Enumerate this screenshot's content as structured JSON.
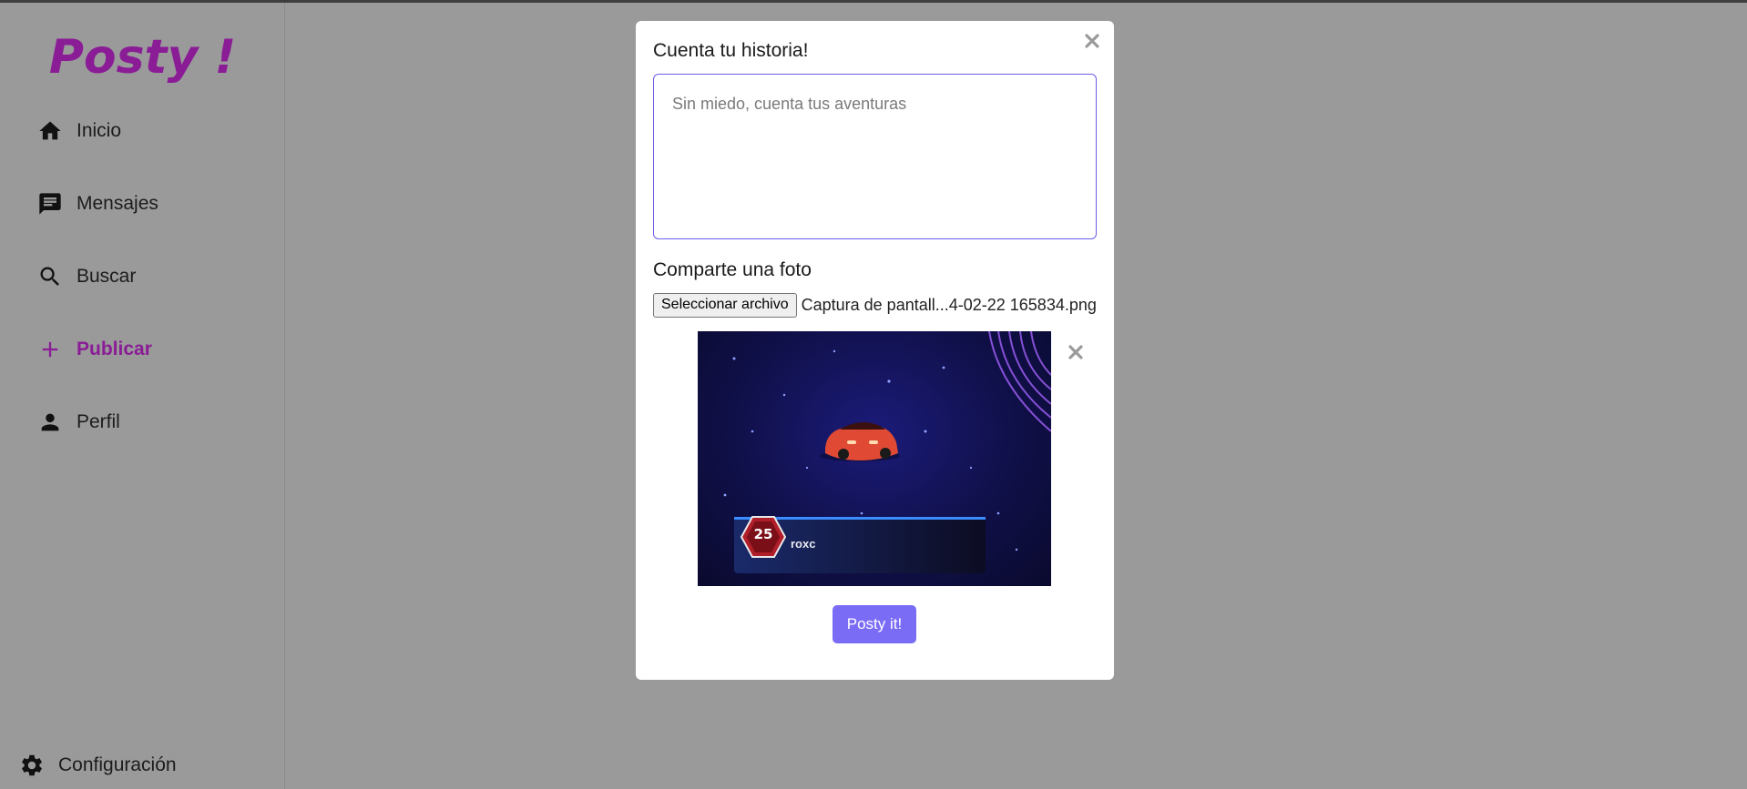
{
  "app": {
    "logo": "Posty !"
  },
  "sidebar": {
    "items": [
      {
        "label": "Inicio",
        "icon": "home-icon"
      },
      {
        "label": "Mensajes",
        "icon": "message-icon"
      },
      {
        "label": "Buscar",
        "icon": "search-icon"
      },
      {
        "label": "Publicar",
        "icon": "plus-icon",
        "active": true
      },
      {
        "label": "Perfil",
        "icon": "person-icon"
      }
    ],
    "settings": {
      "label": "Configuración",
      "icon": "gear-icon"
    }
  },
  "modal": {
    "story_label": "Cuenta tu historia!",
    "story_placeholder": "Sin miedo, cuenta tus aventuras",
    "photo_label": "Comparte una foto",
    "file_button": "Seleccionar archivo",
    "file_name": "Captura de pantall...4-02-22 165834.png",
    "preview": {
      "caption": "roxc",
      "badge_text": "25"
    },
    "submit_label": "Posty it!"
  },
  "colors": {
    "brand": "#8a1c96",
    "accent": "#7b6cf6",
    "overlay": "#9a9a9a"
  }
}
